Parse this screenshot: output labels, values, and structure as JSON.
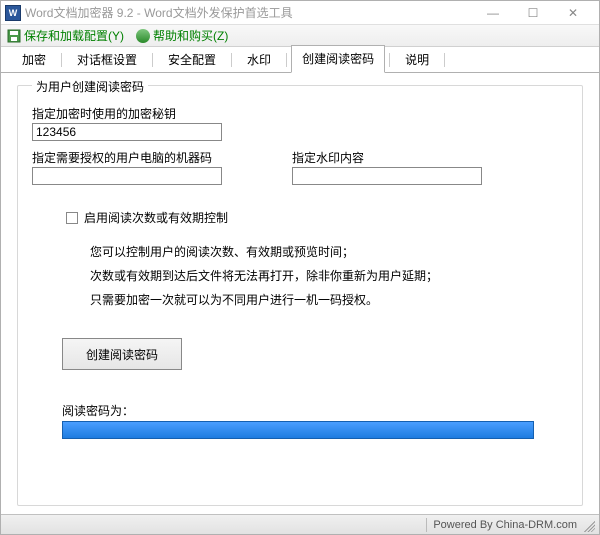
{
  "titlebar": {
    "icon_letter": "W",
    "title": "Word文档加密器 9.2 - Word文档外发保护首选工具"
  },
  "menubar": {
    "save_config": "保存和加载配置(Y)",
    "help_buy": "帮助和购买(Z)"
  },
  "tabs": {
    "items": [
      {
        "label": "加密",
        "active": false
      },
      {
        "label": "对话框设置",
        "active": false
      },
      {
        "label": "安全配置",
        "active": false
      },
      {
        "label": "水印",
        "active": false
      },
      {
        "label": "创建阅读密码",
        "active": true
      },
      {
        "label": "说明",
        "active": false
      }
    ]
  },
  "group": {
    "title": "为用户创建阅读密码",
    "key_label": "指定加密时使用的加密秘钥",
    "key_value": "123456",
    "machine_label": "指定需要授权的用户电脑的机器码",
    "machine_value": "",
    "watermark_label": "指定水印内容",
    "watermark_value": "",
    "checkbox_label": "启用阅读次数或有效期控制",
    "checkbox_checked": false,
    "info_line1": "您可以控制用户的阅读次数、有效期或预览时间；",
    "info_line2": "次数或有效期到达后文件将无法再打开，除非你重新为用户延期；",
    "info_line3": "只需要加密一次就可以为不同用户进行一机一码授权。",
    "create_button": "创建阅读密码",
    "password_label": "阅读密码为：",
    "password_value": ""
  },
  "statusbar": {
    "powered": "Powered By China-DRM.com"
  }
}
